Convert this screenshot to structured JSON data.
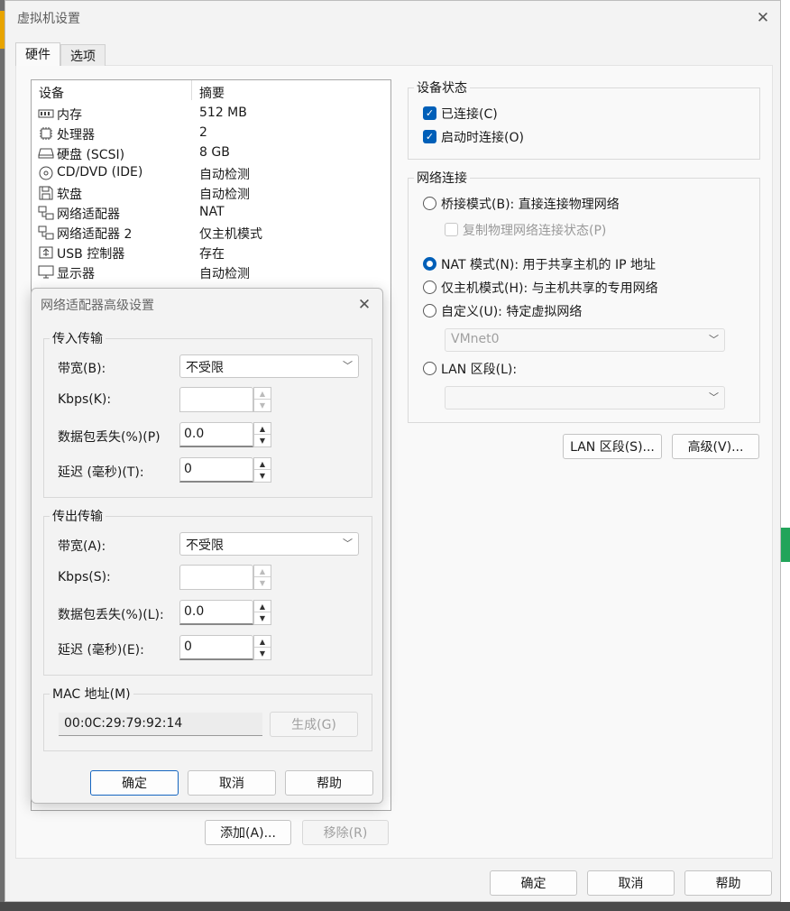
{
  "window": {
    "title": "虚拟机设置"
  },
  "tabs": [
    {
      "label": "硬件"
    },
    {
      "label": "选项"
    }
  ],
  "device_list": {
    "headers": [
      "设备",
      "摘要"
    ],
    "rows": [
      {
        "icon": "memory-icon",
        "name": "内存",
        "summary": "512 MB"
      },
      {
        "icon": "processor-icon",
        "name": "处理器",
        "summary": "2"
      },
      {
        "icon": "harddisk-icon",
        "name": "硬盘 (SCSI)",
        "summary": "8 GB"
      },
      {
        "icon": "cd-dvd-icon",
        "name": "CD/DVD (IDE)",
        "summary": "自动检测"
      },
      {
        "icon": "floppy-icon",
        "name": "软盘",
        "summary": "自动检测"
      },
      {
        "icon": "network-icon",
        "name": "网络适配器",
        "summary": "NAT"
      },
      {
        "icon": "network-icon",
        "name": "网络适配器 2",
        "summary": "仅主机模式"
      },
      {
        "icon": "usb-icon",
        "name": "USB 控制器",
        "summary": "存在"
      },
      {
        "icon": "display-icon",
        "name": "显示器",
        "summary": "自动检测"
      }
    ],
    "add_button": "添加(A)...",
    "remove_button": "移除(R)"
  },
  "device_status": {
    "title": "设备状态",
    "connected": {
      "label": "已连接(C)",
      "checked": true
    },
    "connect_at_power_on": {
      "label": "启动时连接(O)",
      "checked": true
    }
  },
  "network_connection": {
    "title": "网络连接",
    "bridged": {
      "label": "桥接模式(B): 直接连接物理网络",
      "selected": false
    },
    "replicate": {
      "label": "复制物理网络连接状态(P)",
      "checked": false
    },
    "nat": {
      "label": "NAT 模式(N): 用于共享主机的 IP 地址",
      "selected": true
    },
    "host_only": {
      "label": "仅主机模式(H): 与主机共享的专用网络",
      "selected": false
    },
    "custom": {
      "label": "自定义(U): 特定虚拟网络",
      "selected": false
    },
    "custom_value": "VMnet0",
    "lan_segment": {
      "label": "LAN 区段(L):",
      "selected": false
    },
    "lan_value": ""
  },
  "right_buttons": {
    "lan_segments": "LAN 区段(S)...",
    "advanced": "高级(V)..."
  },
  "footer": {
    "ok": "确定",
    "cancel": "取消",
    "help": "帮助"
  },
  "advanced_dialog": {
    "title": "网络适配器高级设置",
    "incoming": {
      "title": "传入传输",
      "bandwidth_label": "带宽(B):",
      "bandwidth_value": "不受限",
      "kbps_label": "Kbps(K):",
      "kbps_value": "",
      "loss_label": "数据包丢失(%)(P)",
      "loss_value": "0.0",
      "latency_label": "延迟 (毫秒)(T):",
      "latency_value": "0"
    },
    "outgoing": {
      "title": "传出传输",
      "bandwidth_label": "带宽(A):",
      "bandwidth_value": "不受限",
      "kbps_label": "Kbps(S):",
      "kbps_value": "",
      "loss_label": "数据包丢失(%)(L):",
      "loss_value": "0.0",
      "latency_label": "延迟 (毫秒)(E):",
      "latency_value": "0"
    },
    "mac": {
      "title": "MAC 地址(M)",
      "value": "00:0C:29:79:92:14",
      "generate": "生成(G)"
    },
    "buttons": {
      "ok": "确定",
      "cancel": "取消",
      "help": "帮助"
    }
  },
  "colors": {
    "accent": "#005fb8",
    "window_bg": "#f3f3f3"
  }
}
